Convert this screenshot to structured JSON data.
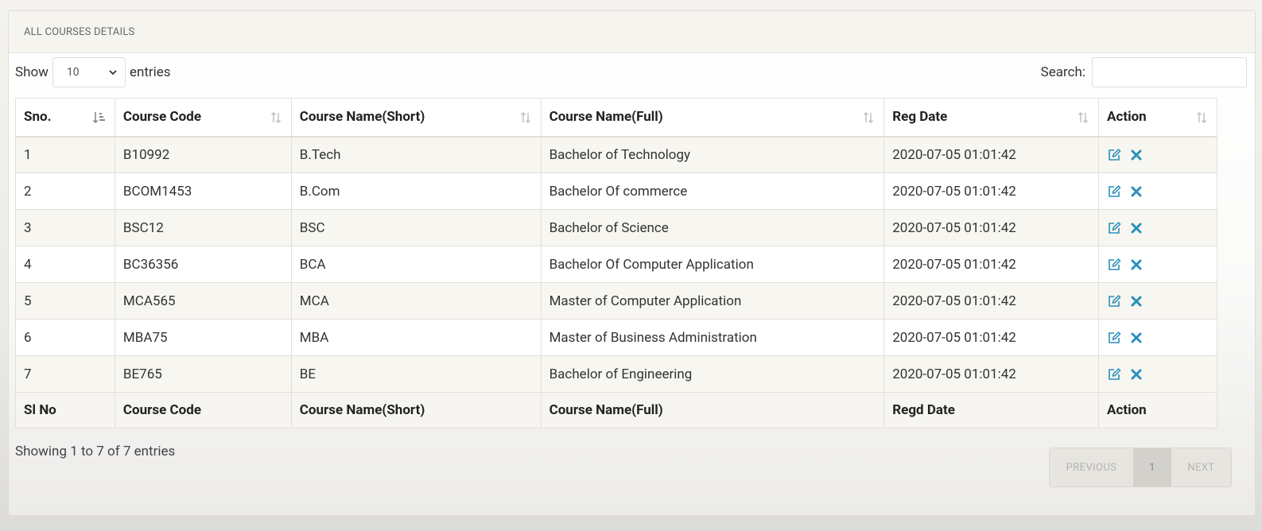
{
  "panel": {
    "title": "ALL COURSES DETAILS"
  },
  "controls": {
    "show_label": "Show",
    "entries_value": "10",
    "entries_label": "entries",
    "search_label": "Search:",
    "search_value": ""
  },
  "table": {
    "headers": [
      "Sno.",
      "Course Code",
      "Course Name(Short)",
      "Course Name(Full)",
      "Reg Date",
      "Action"
    ],
    "footers": [
      "Sl No",
      "Course Code",
      "Course Name(Short)",
      "Course Name(Full)",
      "Regd Date",
      "Action"
    ],
    "rows": [
      [
        "1",
        "B10992",
        "B.Tech",
        "Bachelor of Technology",
        "2020-07-05 01:01:42"
      ],
      [
        "2",
        "BCOM1453",
        "B.Com",
        "Bachelor Of commerce",
        "2020-07-05 01:01:42"
      ],
      [
        "3",
        "BSC12",
        "BSC",
        "Bachelor of Science",
        "2020-07-05 01:01:42"
      ],
      [
        "4",
        "BC36356",
        "BCA",
        "Bachelor Of Computer Application",
        "2020-07-05 01:01:42"
      ],
      [
        "5",
        "MCA565",
        "MCA",
        "Master of Computer Application",
        "2020-07-05 01:01:42"
      ],
      [
        "6",
        "MBA75",
        "MBA",
        "Master of Business Administration",
        "2020-07-05 01:01:42"
      ],
      [
        "7",
        "BE765",
        "BE",
        "Bachelor of Engineering",
        "2020-07-05 01:01:42"
      ]
    ],
    "action_icons": [
      "edit-icon",
      "delete-icon"
    ]
  },
  "footer": {
    "info": "Showing 1 to 7 of 7 entries",
    "prev_label": "PREVIOUS",
    "page": "1",
    "next_label": "NEXT"
  },
  "colors": {
    "accent": "#2a8fbd",
    "header_bg": "#f5f4ee"
  }
}
